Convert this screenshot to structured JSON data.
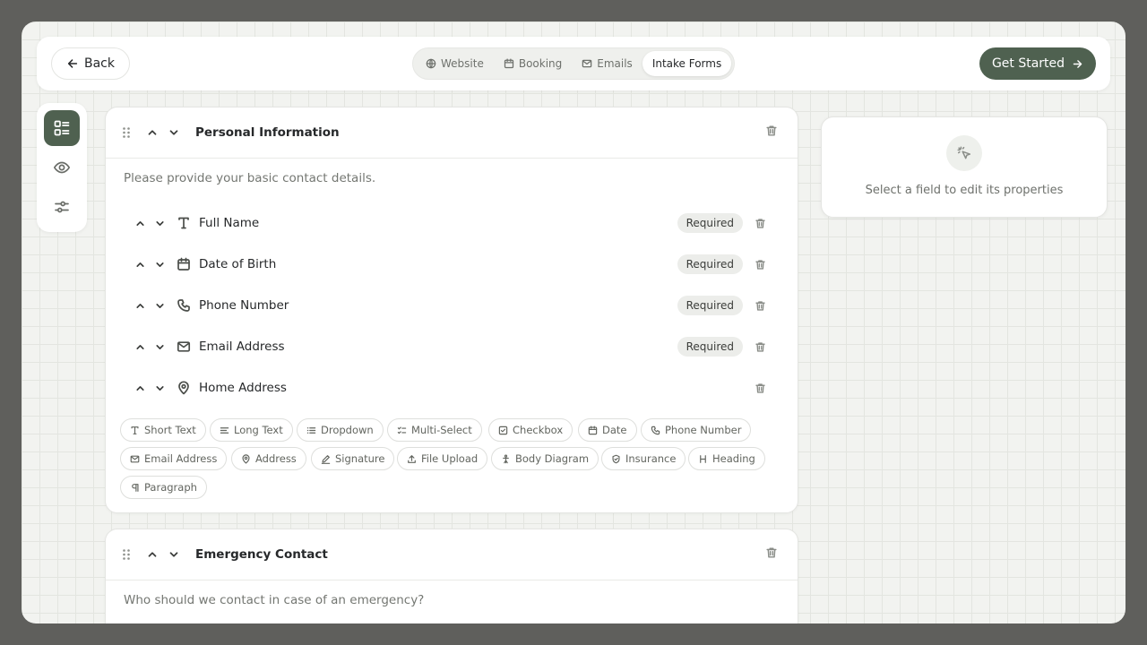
{
  "header": {
    "back_label": "Back",
    "tabs": [
      {
        "label": "Website",
        "icon": "globe-icon",
        "active": false
      },
      {
        "label": "Booking",
        "icon": "calendar-icon",
        "active": false
      },
      {
        "label": "Emails",
        "icon": "mail-icon",
        "active": false
      },
      {
        "label": "Intake Forms",
        "icon": "",
        "active": true
      }
    ],
    "cta_label": "Get Started"
  },
  "colors": {
    "primary": "#4f6150",
    "background": "#f2f3f0"
  },
  "rail": [
    "form-builder-icon",
    "preview-eye-icon",
    "settings-sliders-icon"
  ],
  "sections": [
    {
      "title": "Personal Information",
      "description": "Please provide your basic contact details.",
      "fields": [
        {
          "label": "Full Name",
          "icon": "text-icon",
          "badge": "Required"
        },
        {
          "label": "Date of Birth",
          "icon": "calendar-icon",
          "badge": "Required"
        },
        {
          "label": "Phone Number",
          "icon": "phone-icon",
          "badge": "Required"
        },
        {
          "label": "Email Address",
          "icon": "mail-icon",
          "badge": "Required"
        },
        {
          "label": "Home Address",
          "icon": "map-pin-icon",
          "badge": ""
        }
      ]
    },
    {
      "title": "Emergency Contact",
      "description": "Who should we contact in case of an emergency?"
    }
  ],
  "field_types": [
    "Short Text",
    "Long Text",
    "Dropdown",
    "Multi-Select",
    "Checkbox",
    "Date",
    "Phone Number",
    "Email Address",
    "Address",
    "Signature",
    "File Upload",
    "Body Diagram",
    "Insurance",
    "Heading",
    "Paragraph"
  ],
  "properties": {
    "empty_text": "Select a field to edit its properties"
  }
}
